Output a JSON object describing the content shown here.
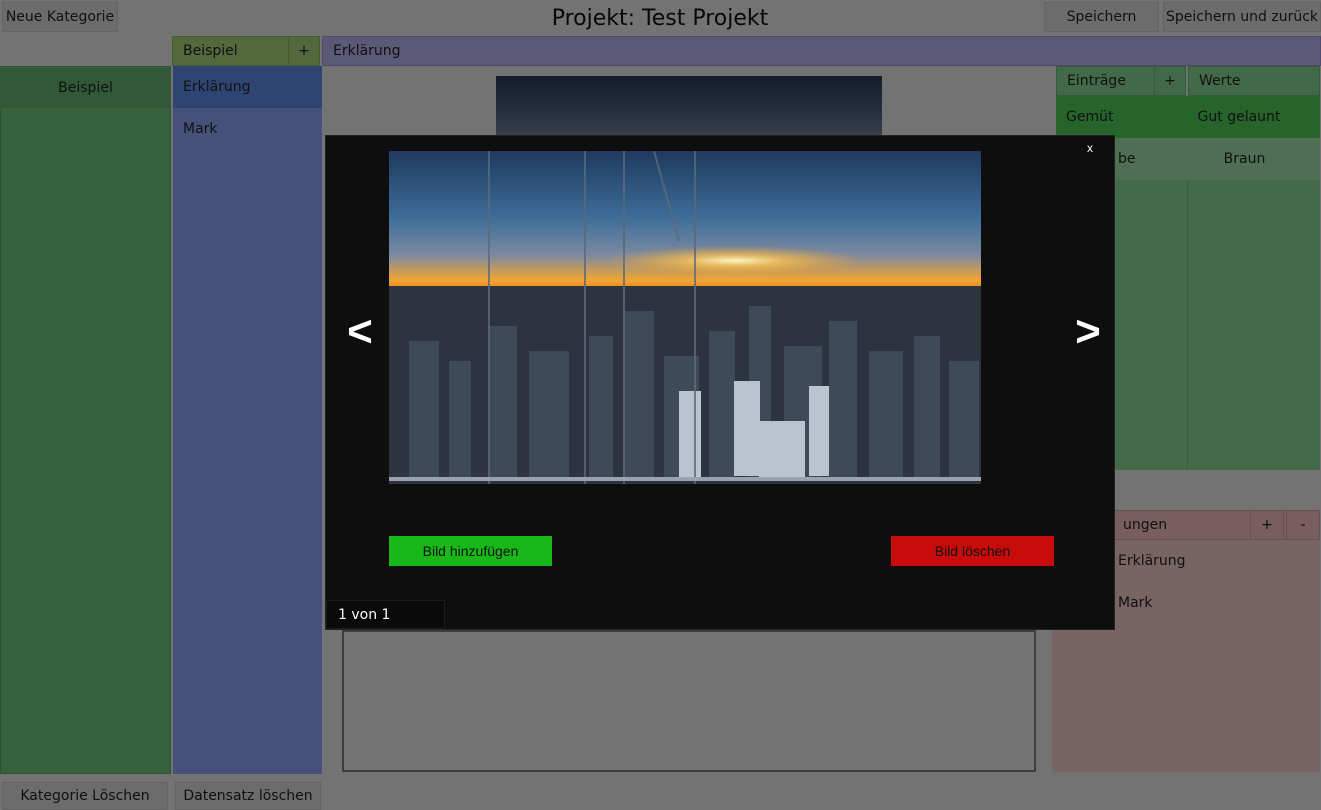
{
  "header": {
    "new_category": "Neue Kategorie",
    "title": "Projekt: Test Projekt",
    "save": "Speichern",
    "save_back": "Speichern und zurück"
  },
  "categories": {
    "items": [
      "Beispiel"
    ],
    "delete": "Kategorie Löschen"
  },
  "datasets": {
    "header": "Beispiel",
    "add": "+",
    "items": [
      "Erklärung",
      "Mark"
    ],
    "delete": "Datensatz löschen"
  },
  "center": {
    "header": "Erklärung"
  },
  "entries": {
    "header": "Einträge",
    "add": "+",
    "values_header": "Werte",
    "rows": [
      {
        "key": "Gemüt",
        "value": "Gut gelaunt"
      },
      {
        "key": "be",
        "value": "Braun"
      }
    ]
  },
  "links": {
    "header": "ungen",
    "add": "+",
    "remove": "-",
    "items": [
      "Erklärung",
      "Mark"
    ]
  },
  "modal": {
    "close": "x",
    "prev": "<",
    "next": ">",
    "add_image": "Bild hinzufügen",
    "delete_image": "Bild löschen",
    "counter": "1 von 1"
  }
}
